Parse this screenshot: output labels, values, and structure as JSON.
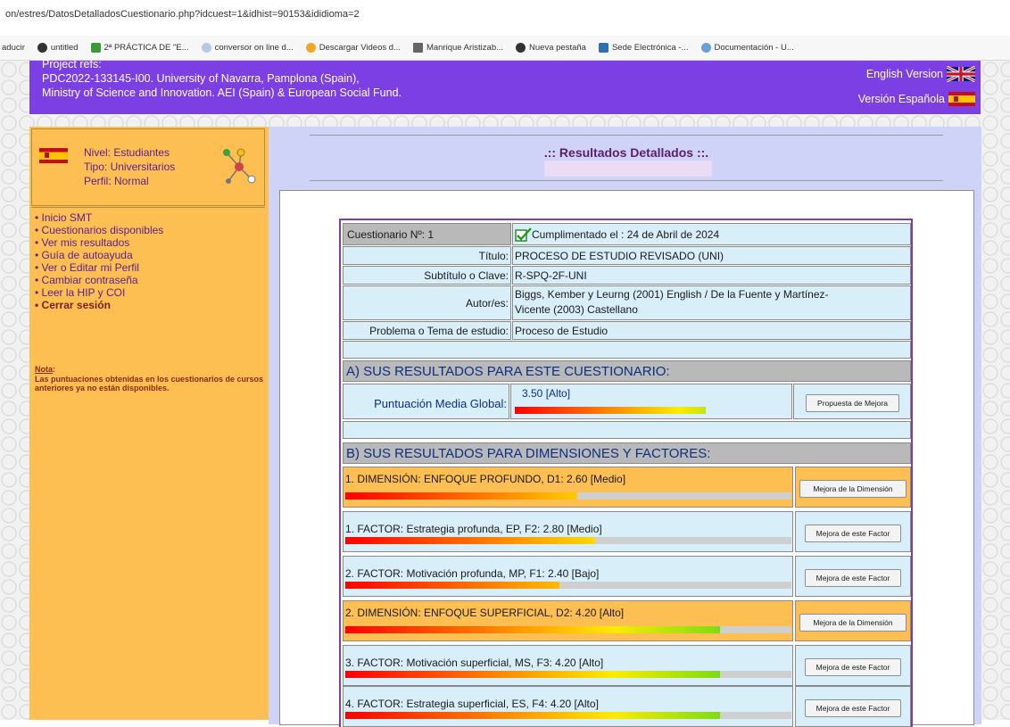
{
  "browser": {
    "url": "on/estres/DatosDetalladosCuestionario.php?idcuest=1&idhist=90153&ididioma=2",
    "bookmarks": [
      "aducir",
      "untitled",
      "2ª PRÁCTICA DE \"E...",
      "conversor on line d...",
      "Descargar Videos d...",
      "Manrique Aristizab...",
      "Nueva pestaña",
      "Sede Electrónica -...",
      "Documentación - U..."
    ]
  },
  "header": {
    "line0": "Project refs:",
    "line1": "PDC2022-133145-I00. University of Navarra, Pamplona (Spain),",
    "line2": "Ministry of Science and Innovation. AEI (Spain) & European Social Fund.",
    "english": "English Version",
    "spanish": "Versión Española"
  },
  "profile": {
    "nivel": "Nivel: Estudiantes",
    "tipo": "Tipo: Universitarios",
    "perfil": "Perfil: Normal"
  },
  "menu": [
    "• Inicio SMT",
    "• Cuestionarios disponibles",
    "• Ver mis resultados",
    "• Guía de autoayuda",
    "• Ver o Editar mi Perfil",
    "• Cambiar contraseña",
    "• Leer la HIP y COI",
    "• Cerrar sesión"
  ],
  "note": {
    "label": "Nota",
    "colon": ":",
    "text": "Las puntuaciones obtenidas en los cuestionarios de cursos anteriores ya no están disponibles."
  },
  "main": {
    "title": ".:: Resultados Detallados ::."
  },
  "questionnaire": {
    "number": "Cuestionario Nº: 1",
    "completed": "Cumplimentado el : 24 de Abril de 2024",
    "rows": [
      {
        "label": "Título:",
        "value": "PROCESO DE ESTUDIO REVISADO (UNI)"
      },
      {
        "label": "Subtítulo o Clave:",
        "value": "R-SPQ-2F-UNI"
      },
      {
        "label": "Autor/es:",
        "value": "Biggs, Kember y Leurng (2001) English / De la Fuente y Martínez-",
        "value2": "Vicente (2003) Castellano"
      },
      {
        "label": "Problema o Tema de estudio:",
        "value": "Proceso de Estudio"
      }
    ]
  },
  "section_a": {
    "title": "A) SUS RESULTADOS PARA ESTE CUESTIONARIO:",
    "global_label": "Puntuación Media Global:",
    "global_value": "3.50 [Alto]",
    "score": 3.5,
    "button": "Propuesta de Mejora"
  },
  "section_b": {
    "title": "B) SUS RESULTADOS PARA DIMENSIONES Y FACTORES:",
    "rows": [
      {
        "text": "1. DIMENSIÓN: ENFOQUE PROFUNDO, D1: 2.60 [Medio]",
        "score": 2.6,
        "kind": "dimension",
        "button": "Mejora de la Dimensión"
      },
      {
        "text": "1. FACTOR: Estrategia profunda, EP, F2: 2.80 [Medio]",
        "score": 2.8,
        "kind": "factor",
        "button": "Mejora de este Factor"
      },
      {
        "text": "2. FACTOR: Motivación profunda, MP, F1: 2.40 [Bajo]",
        "score": 2.4,
        "kind": "factor",
        "button": "Mejora de este Factor"
      },
      {
        "text": "2. DIMENSIÓN: ENFOQUE SUPERFICIAL, D2: 4.20 [Alto]",
        "score": 4.2,
        "kind": "dimension",
        "button": "Mejora de la Dimensión"
      },
      {
        "text": "3. FACTOR: Motivación superficial, MS, F3: 4.20 [Alto]",
        "score": 4.2,
        "kind": "factor",
        "button": "Mejora de este Factor"
      },
      {
        "text": "4. FACTOR: Estrategia superficial, ES, F4: 4.20 [Alto]",
        "score": 4.2,
        "kind": "factor",
        "button": "Mejora de este Factor"
      }
    ]
  },
  "colors": {
    "header": "#7b3fe4",
    "sidebar": "#fdbf52",
    "cell": "#d8eef9",
    "dimension_row": "#fdbf52",
    "section_header": "#b9b9b9",
    "section_text": "#0c2f86",
    "menu_text": "#5a1f8f"
  },
  "icons": [
    "chrome-favicon-icon",
    "leaf-favicon-icon",
    "converter-favicon-icon",
    "video-favicon-icon",
    "pdf-favicon-icon",
    "sede-favicon-icon",
    "doc-favicon-icon",
    "uk-flag-icon",
    "spain-flag-icon",
    "network-icon",
    "checkbox-check-icon"
  ]
}
